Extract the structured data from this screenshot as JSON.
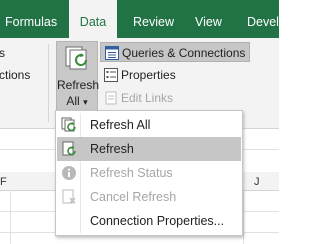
{
  "ribbon_tabs": [
    {
      "label": "Formulas"
    },
    {
      "label": "Data"
    },
    {
      "label": "Review"
    },
    {
      "label": "View"
    },
    {
      "label": "Develo"
    }
  ],
  "ribbon": {
    "partial_left_labels": [
      "s",
      "ctions"
    ],
    "refresh_all_button": {
      "line1": "Refresh",
      "line2": "All",
      "caret": "▾"
    },
    "queries_connections": "Queries & Connections",
    "properties": "Properties",
    "edit_links": "Edit Links"
  },
  "column_headers": [
    "F",
    "J"
  ],
  "refresh_menu": {
    "items": [
      {
        "label": "Refresh All",
        "icon": "refresh-all-icon",
        "state": "normal"
      },
      {
        "label": "Refresh",
        "icon": "refresh-icon",
        "state": "hover"
      },
      {
        "label": "Refresh Status",
        "icon": "info-icon",
        "state": "disabled"
      },
      {
        "label": "Cancel Refresh",
        "icon": "cancel-refresh-icon",
        "state": "disabled"
      },
      {
        "label": "Connection Properties...",
        "icon": "",
        "state": "normal"
      }
    ]
  },
  "colors": {
    "excel_green": "#217346",
    "ribbon_bg": "#f3f3f3",
    "hover_bg": "#c6c6c6",
    "disabled_text": "#a6a6a6"
  }
}
